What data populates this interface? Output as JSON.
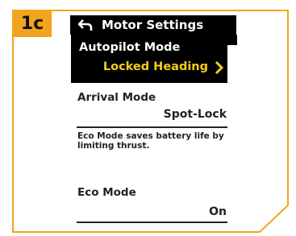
{
  "step": {
    "label": "1c"
  },
  "screen": {
    "title": "Motor Settings",
    "rows": [
      {
        "label": "Autopilot Mode",
        "value": "Locked Heading",
        "selected": true
      },
      {
        "label": "Arrival Mode",
        "value": "Spot-Lock"
      },
      {
        "label": "Eco Mode",
        "value": "On"
      }
    ],
    "eco_note": "Eco Mode saves battery life by limiting thrust."
  },
  "colors": {
    "frame": "#f2a41e",
    "selected_background": "#000000",
    "selected_value": "#f6cd15",
    "text": "#222222"
  },
  "icons": {
    "back": "back-arrow-icon",
    "chevron": "chevron-right-icon"
  }
}
